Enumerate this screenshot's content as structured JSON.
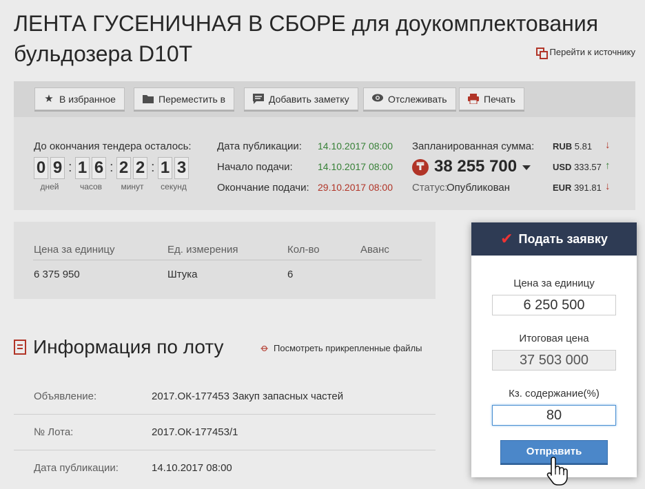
{
  "page": {
    "title": "ЛЕНТА ГУСЕНИЧНАЯ В СБОРЕ для доукомплектования бульдозера D10T",
    "source_link": "Перейти к источнику"
  },
  "toolbar": {
    "favorite": "В избранное",
    "move": "Переместить в",
    "note": "Добавить заметку",
    "track": "Отслеживать",
    "print": "Печать"
  },
  "timer": {
    "label": "До окончания тендера осталось:",
    "digits": [
      "0",
      "9",
      "1",
      "6",
      "2",
      "2",
      "1",
      "3"
    ],
    "units": [
      "дней",
      "часов",
      "минут",
      "секунд"
    ]
  },
  "dates": {
    "published_label": "Дата публикации:",
    "published_value": "14.10.2017 08:00",
    "start_label": "Начало подачи:",
    "start_value": "14.10.2017 08:00",
    "end_label": "Окончание подачи:",
    "end_value": "29.10.2017 08:00"
  },
  "budget": {
    "label": "Запланированная сумма:",
    "currency_symbol": "₸",
    "amount": "38 255 700",
    "status_label": "Статус:",
    "status_value": "Опубликован"
  },
  "rates": [
    {
      "code": "RUB",
      "value": "5.81",
      "trend": "down",
      "arrow": "↓"
    },
    {
      "code": "USD",
      "value": "333.57",
      "trend": "up",
      "arrow": "↑"
    },
    {
      "code": "EUR",
      "value": "391.81",
      "trend": "down",
      "arrow": "↓"
    }
  ],
  "colors": {
    "accent_red": "#c0392b",
    "green": "#3c8c3c",
    "modal_header": "#2e3b54",
    "button_blue": "#4b87c9"
  },
  "lot_table": {
    "headers": [
      "Цена за единицу",
      "Ед. измерения",
      "Кол-во",
      "Аванс"
    ],
    "row": [
      "6 375 950",
      "Штука",
      "6",
      ""
    ]
  },
  "lot_info": {
    "title": "Информация по лоту",
    "files_link": "Посмотреть прикрепленные файлы",
    "rows": [
      {
        "key": "Объявление:",
        "value": "2017.ОК-177453 Закуп запасных частей"
      },
      {
        "key": "№ Лота:",
        "value": "2017.ОК-177453/1"
      },
      {
        "key": "Дата публикации:",
        "value": "14.10.2017 08:00"
      }
    ]
  },
  "bid_modal": {
    "title": "Подать заявку",
    "unit_price_label": "Цена за единицу",
    "unit_price_value": "6 250 500",
    "total_label": "Итоговая цена",
    "total_value": "37 503 000",
    "kz_label": "Кз. содержание(%)",
    "kz_value": "80",
    "submit": "Отправить"
  }
}
